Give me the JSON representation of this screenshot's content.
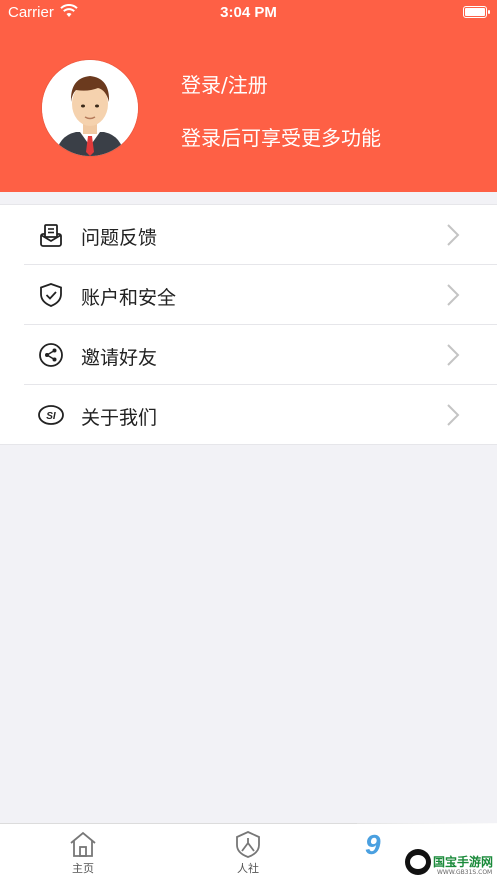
{
  "status_bar": {
    "carrier": "Carrier",
    "time": "3:04 PM"
  },
  "header": {
    "login_title": "登录/注册",
    "login_subtitle": "登录后可享受更多功能",
    "background_color": "#fe6045"
  },
  "menu": {
    "items": [
      {
        "label": "问题反馈",
        "icon": "feedback-mail-icon"
      },
      {
        "label": "账户和安全",
        "icon": "shield-check-icon"
      },
      {
        "label": "邀请好友",
        "icon": "share-icon"
      },
      {
        "label": "关于我们",
        "icon": "si-logo-icon"
      }
    ]
  },
  "tabbar": {
    "tabs": [
      {
        "label": "主页",
        "icon": "home-icon"
      },
      {
        "label": "人社",
        "icon": "person-shield-icon"
      }
    ]
  },
  "watermark": {
    "brand": "9",
    "text": "国宝手游网",
    "url": "WWW.GB31S.COM"
  }
}
